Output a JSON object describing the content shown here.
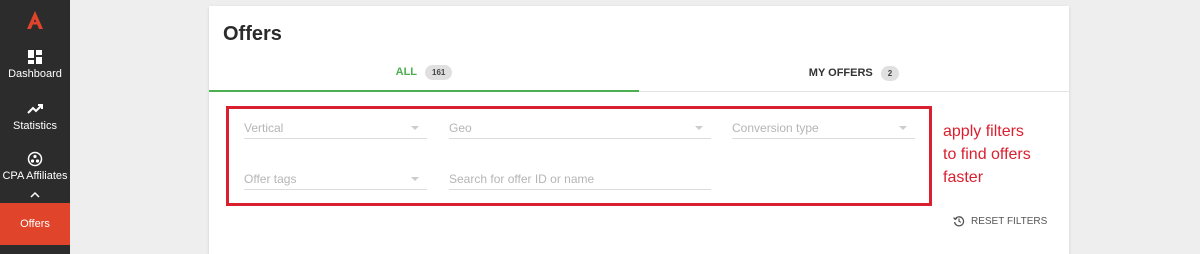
{
  "sidebar": {
    "items": [
      {
        "label": "Dashboard",
        "icon": "dashboard-icon"
      },
      {
        "label": "Statistics",
        "icon": "trending-up-icon"
      },
      {
        "label": "CPA Affiliates",
        "icon": "affiliates-icon"
      },
      {
        "label": "Offers",
        "icon": "",
        "active": true
      }
    ],
    "logo_color": "#e0442a",
    "bg_color": "#2c2c2c",
    "active_color": "#e0442a"
  },
  "page": {
    "title": "Offers"
  },
  "tabs": [
    {
      "label": "ALL",
      "count": "161",
      "active": true
    },
    {
      "label": "MY OFFERS",
      "count": "2",
      "active": false
    }
  ],
  "filters": {
    "vertical_placeholder": "Vertical",
    "geo_placeholder": "Geo",
    "conversion_placeholder": "Conversion type",
    "tags_placeholder": "Offer tags",
    "search_placeholder": "Search for offer ID or name",
    "reset_label": "RESET FILTERS"
  },
  "annotation": {
    "lines": [
      "apply filters",
      "to find offers",
      "faster"
    ],
    "color": "#d9202f"
  },
  "accent_color": "#4caf50"
}
